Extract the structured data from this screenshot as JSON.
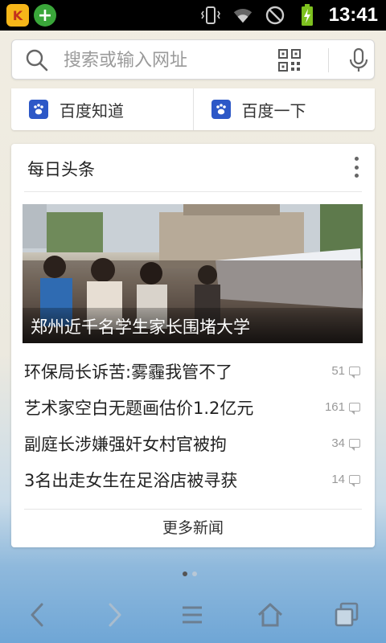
{
  "status_bar": {
    "time": "13:41",
    "app_badges": [
      "k-app-icon",
      "plus-app-icon"
    ],
    "icons": [
      "vibrate-icon",
      "wifi-icon",
      "no-sim-icon",
      "battery-charging-icon"
    ]
  },
  "search": {
    "placeholder": "搜索或输入网址"
  },
  "quick_links": [
    {
      "label": "百度知道",
      "icon": "baidu-paw-icon"
    },
    {
      "label": "百度一下",
      "icon": "baidu-paw-icon"
    }
  ],
  "news_card": {
    "title": "每日头条",
    "headline": {
      "caption": "郑州近千名学生家长围堵大学"
    },
    "items": [
      {
        "title": "环保局长诉苦:雾霾我管不了",
        "comments": "51"
      },
      {
        "title": "艺术家空白无题画估价1.2亿元",
        "comments": "161"
      },
      {
        "title": "副庭长涉嫌强奸女村官被拘",
        "comments": "34"
      },
      {
        "title": "3名出走女生在足浴店被寻获",
        "comments": "14"
      }
    ],
    "more_label": "更多新闻"
  },
  "page_indicator": {
    "count": 2,
    "active": 0
  },
  "toolbar": {
    "buttons": [
      "back-icon",
      "forward-icon",
      "menu-icon",
      "home-icon",
      "tabs-icon"
    ]
  },
  "colors": {
    "accent_blue": "#2d58c7",
    "status_bar_bg": "#000000",
    "battery_green": "#7ec11f"
  }
}
